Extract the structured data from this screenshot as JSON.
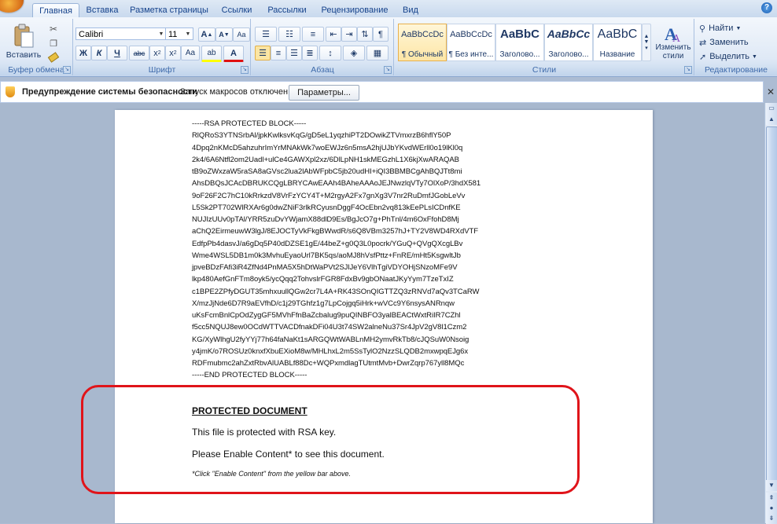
{
  "tabs": [
    "Главная",
    "Вставка",
    "Разметка страницы",
    "Ссылки",
    "Рассылки",
    "Рецензирование",
    "Вид"
  ],
  "ribbon": {
    "clipboard": {
      "label": "Буфер обмена",
      "paste_label": "Вставить"
    },
    "font": {
      "label": "Шрифт",
      "font_name": "Calibri",
      "font_size": "11",
      "grow": "A",
      "shrink": "A",
      "clear": "Aa",
      "bold": "Ж",
      "italic": "К",
      "underline": "Ч",
      "strike": "abc",
      "subscript": "x",
      "superscript": "x",
      "case": "Aa",
      "highlight": "ab",
      "color": "A"
    },
    "paragraph": {
      "label": "Абзац"
    },
    "styles": {
      "label": "Стили",
      "items": [
        {
          "sample": "AaBbCcDc",
          "name": "¶ Обычный"
        },
        {
          "sample": "AaBbCcDc",
          "name": "¶ Без инте..."
        },
        {
          "sample": "AaBbC",
          "name": "Заголово..."
        },
        {
          "sample": "AaBbCc",
          "name": "Заголово..."
        },
        {
          "sample": "AaBbC",
          "name": "Название"
        }
      ],
      "change_styles": "Изменить стили"
    },
    "editing": {
      "label": "Редактирование",
      "find": "Найти",
      "replace": "Заменить",
      "select": "Выделить"
    }
  },
  "security_bar": {
    "title": "Предупреждение системы безопасности",
    "message": "Запуск макросов отключен.",
    "button": "Параметры..."
  },
  "document": {
    "rsa_lines": [
      "-----RSA PROTECTED BLOCK-----",
      "RlQRoS3YTNSrbAl/jpkKwlksvKqG/gD5eL1yqzhiPT2DOwikZTVmxrzB6hflY50P",
      "4Dpq2nKMcD5ahzuhrImYrMNAkWk7woEWJz6n5msA2hjUJbYKvdWErll0o19lKl0q",
      "2k4/6A6Ntfl2om2Uadl+ulCe4GAWXpl2xz/6DlLpNH1skMEGzhL1X6kjXwARAQAB",
      "tB9oZWxzaW5raSA8aGVsc2lua2lAbWFpbC5jb20udHI+iQI3BBMBCgAhBQJTt8mi",
      "AhsDBQsJCAcDBRUKCQgLBRYCAwEAAh4BAheAAAoJEJNwzlqVTy7OlXoP/3hdX581",
      "9oF26F2C7hC10kRrkzdV8VrFzYCY4T+M2rgyA2Fx7gnXg3V7nr2RuDmfJGobLeVv",
      "L5Sk2PT702WlRXAr6g0dwZNiF3rlkRCyusnDggF4OcEbn2vq813kEePLsICDnfKE",
      "NUJIzUUv0pTAl/YRR5zuDvYWjamX88dlD9Es/BgJcO7g+PhTnl/4m6OxFfohD8Mj",
      "aChQ2EirmeuwW3lgJ/8EJOCTyVkFkgBWwdR/s6Q8VBm3257hJ+TY2V8WD4RXdVTF",
      "EdfpPb4dasvJ/a6gDq5P40dDZSE1gE/44beZ+g0Q3L0pocrk/YGuQ+QVgQXcgLBv",
      "Wme4WSL5DB1m0k3MvhuEyaoUrl7BK5qs/aoMJ8hVsfPttz+FnRE/mHt5KsgwltJb",
      "jpveBDzFAfi3iR4ZfNd4PnMA5X5hDtWaPVt2SJlJeY6VlhTgiVDYOHjSNzoMFe9V",
      "lkp480AefGnFTm8oyk5/ycQqq2TohvslrFGR8FdxBv9gbONaatJKyYym7TzeTxIZ",
      "c1BPE2ZPfyDGUT35mhxuullQGw2cr7L4A+RK43SOnQIGTTZQ3zRNVd7aQv3TCaRW",
      "X/mzJjNde6D7R9aEVfhD/c1j29TGhfz1g7LpCojgq5iHrk+wVCc9Y6nsysANRnqw",
      "uKsFcmBnlCpOdZygGF5MVhFfnBaZcbalug9puQINBFO3yalBEACtWxtRiIR7CZhl",
      "f5cc5NQUJ8ew0OCdWTTVACDfnakDFi04U3t74SW2alneNu37Sr4JpV2gV8l1Czm2",
      "KG/XyWlhgU2fyYYj77h64faNaKt1sARGQWtWABLnMH2ymvRkTb8/cJQSuW0Nsoig",
      "y4jmK/o7ROSUz0knxfXbuEXioM8w/MHLhxL2m5SsTylO2NzzSLQDB2mxwpqEJg6x",
      "RDFmubmc2ahZxtRbvAlUABLf88Dc+WQPxmdlagTUtmtMvb+DwrZqrp767yll8MQc",
      "-----END PROTECTED BLOCK-----"
    ],
    "protected_title": "PROTECTED DOCUMENT",
    "line1": "This file is protected with RSA key.",
    "line2": "Please Enable Content* to see this document.",
    "note": "*Click \"Enable Content\" from the yellow bar above."
  },
  "colors": {
    "highlight_box": "#e0141a",
    "ribbon_text": "#15428b",
    "security_icon": "#f0a020"
  }
}
